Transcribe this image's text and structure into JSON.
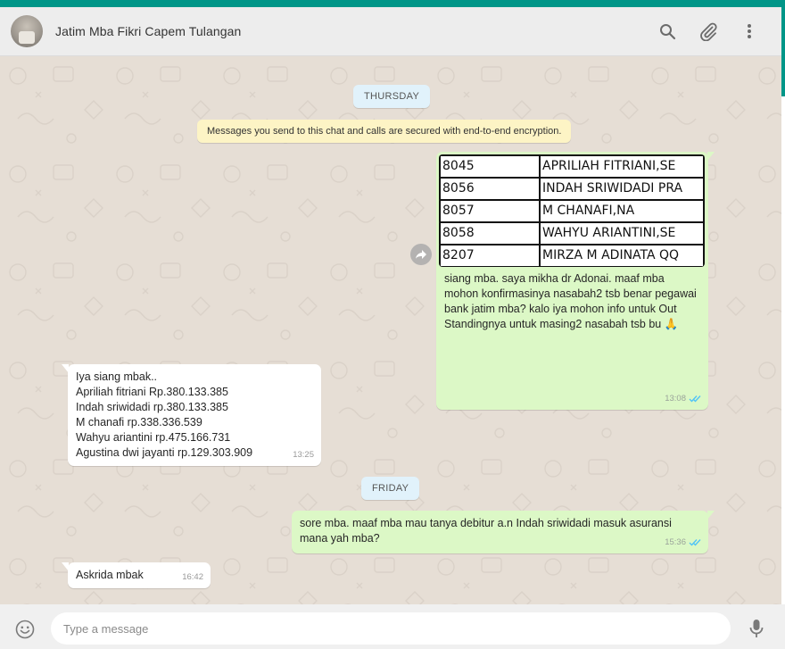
{
  "header": {
    "chat_name": "Jatim Mba Fikri Capem Tulangan",
    "icons": [
      "search-icon",
      "attach-icon",
      "menu-icon"
    ]
  },
  "colors": {
    "accent": "#009688",
    "outgoing_bubble": "#dcf8c6",
    "incoming_bubble": "#ffffff",
    "chat_bg": "#e6ded5",
    "date_chip": "#e1f2fb",
    "system_chip": "#fdf4c5",
    "read_ticks": "#4fc3f7"
  },
  "chat": {
    "date_thursday": "THURSDAY",
    "encryption_notice": "Messages you send to this chat and calls are secured with end-to-end encryption.",
    "msg1": {
      "table_rows": [
        {
          "code": "8045",
          "name": "APRILIAH FITRIANI,SE"
        },
        {
          "code": "8056",
          "name": "INDAH SRIWIDADI PRA"
        },
        {
          "code": "8057",
          "name": "M CHANAFI,NA"
        },
        {
          "code": "8058",
          "name": "WAHYU ARIANTINI,SE"
        },
        {
          "code": "8207",
          "name": "MIRZA M ADINATA QQ"
        }
      ],
      "lines": [
        "siang mba. saya mikha dr Adonai. maaf mba",
        "mohon konfirmasinya nasabah2 tsb benar pegawai",
        "bank jatim mba? kalo iya mohon info untuk Out",
        "Standingnya untuk masing2 nasabah tsb bu 🙏"
      ],
      "time": "13:08"
    },
    "msg2": {
      "lines": [
        "Iya siang mbak..",
        "Apriliah fitriani Rp.380.133.385",
        "Indah sriwidadi rp.380.133.385",
        "M chanafi rp.338.336.539",
        "Wahyu ariantini rp.475.166.731",
        "Agustina dwi jayanti rp.129.303.909"
      ],
      "time": "13:25"
    },
    "date_friday": "FRIDAY",
    "msg3": {
      "lines": [
        "sore mba. maaf mba mau tanya debitur a.n Indah sriwidadi masuk asuransi",
        "mana yah mba?"
      ],
      "time": "15:36"
    },
    "msg4": {
      "text": "Askrida mbak",
      "time": "16:42"
    }
  },
  "composer": {
    "placeholder": "Type a message",
    "value": ""
  }
}
